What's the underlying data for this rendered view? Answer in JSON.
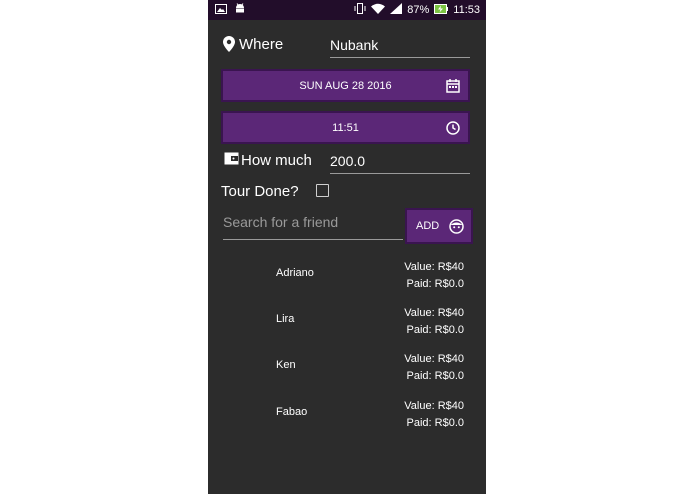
{
  "status_bar": {
    "battery_pct": "87%",
    "time": "11:53",
    "icons": [
      "gallery-icon",
      "android-icon",
      "vibrate-icon",
      "wifi-icon",
      "signal-icon",
      "battery-icon"
    ]
  },
  "form": {
    "where_label": "Where",
    "where_value": "Nubank",
    "date_button": "SUN AUG 28 2016",
    "time_button": "11:51",
    "how_much_label": "How much",
    "how_much_value": "200.0",
    "tour_done_label": "Tour Done?",
    "tour_done_checked": false,
    "search_placeholder": "Search for a friend",
    "add_label": "ADD"
  },
  "friends": [
    {
      "name": "Adriano",
      "value": "Value: R$40",
      "paid": "Paid: R$0.0"
    },
    {
      "name": "Lira",
      "value": "Value: R$40",
      "paid": "Paid: R$0.0"
    },
    {
      "name": "Ken",
      "value": "Value: R$40",
      "paid": "Paid: R$0.0"
    },
    {
      "name": "Fabao",
      "value": "Value: R$40",
      "paid": "Paid: R$0.0"
    }
  ],
  "colors": {
    "accent": "#5b2777",
    "background": "#2c2c2c",
    "status_bar": "#220d2a"
  }
}
